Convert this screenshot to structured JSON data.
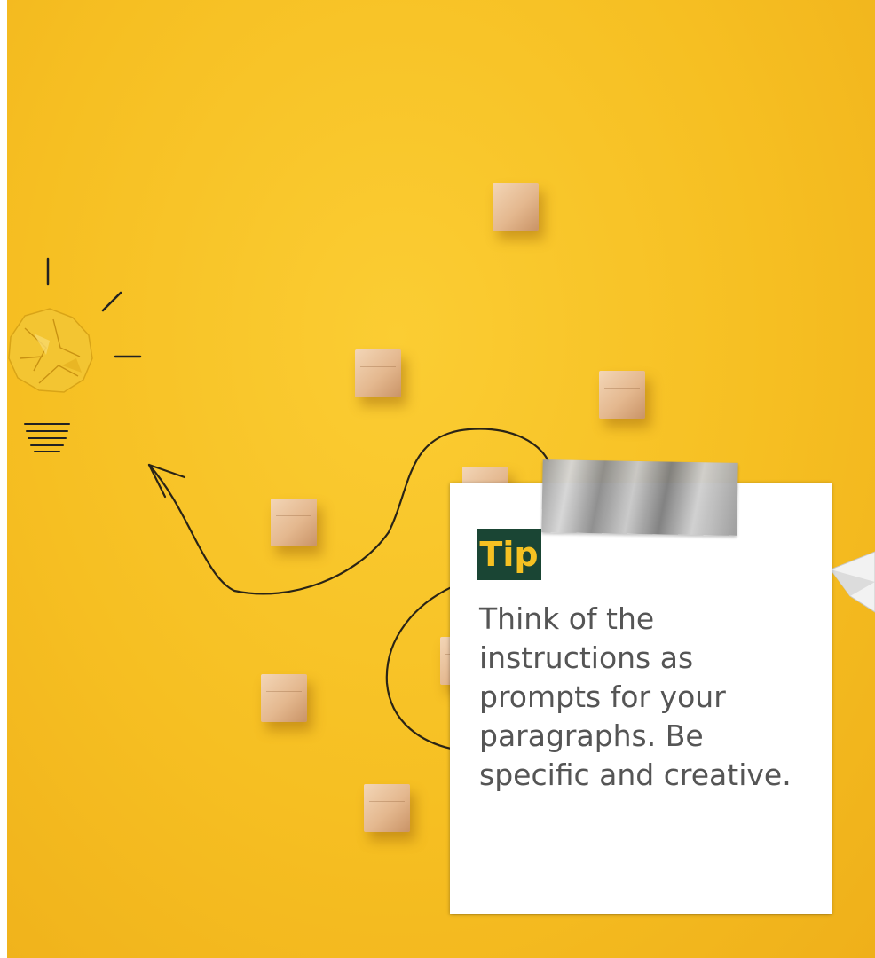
{
  "tip": {
    "heading": "Tip",
    "body": "Think of the instructions as prompts for your paragraphs. Be specific and creative."
  },
  "colors": {
    "background": "#f6bf22",
    "badge_background": "#1a4534",
    "badge_text": "#f6c122",
    "body_text": "#555555",
    "card": "#ffffff"
  },
  "icons": [
    "crumpled-paper-lightbulb-icon",
    "arrow-line-icon",
    "paper-plane-icon",
    "tape-icon"
  ]
}
